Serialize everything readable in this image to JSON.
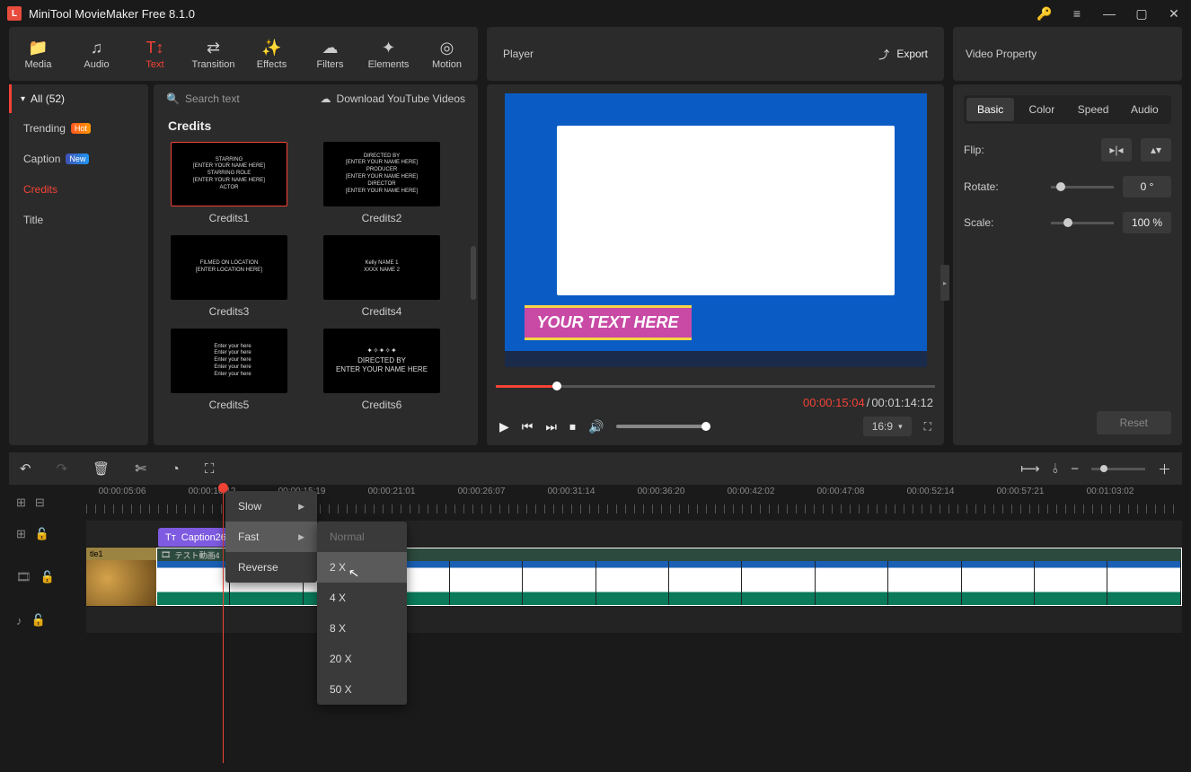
{
  "app": {
    "title": "MiniTool MovieMaker Free 8.1.0"
  },
  "tabs": {
    "media": "Media",
    "audio": "Audio",
    "text": "Text",
    "transition": "Transition",
    "effects": "Effects",
    "filters": "Filters",
    "elements": "Elements",
    "motion": "Motion"
  },
  "player": {
    "title": "Player",
    "export": "Export"
  },
  "props_panel": {
    "title": "Video Property",
    "tabs": {
      "basic": "Basic",
      "color": "Color",
      "speed": "Speed",
      "audio": "Audio"
    },
    "flip": "Flip:",
    "rotate": "Rotate:",
    "rotate_val": "0 °",
    "scale": "Scale:",
    "scale_val": "100 %",
    "reset": "Reset"
  },
  "library": {
    "all": "All (52)",
    "categories": {
      "trending": "Trending",
      "caption": "Caption",
      "credits": "Credits",
      "title": "Title"
    },
    "badges": {
      "hot": "Hot",
      "new": "New"
    },
    "search_placeholder": "Search text",
    "yt": "Download YouTube Videos",
    "section": "Credits",
    "items": [
      "Credits1",
      "Credits2",
      "Credits3",
      "Credits4",
      "Credits5",
      "Credits6"
    ],
    "thumb_texts": {
      "c1": "STARRING\n[ENTER YOUR NAME HERE]\nSTARRING ROLE\n[ENTER YOUR NAME HERE]\nACTOR",
      "c2": "DIRECTED BY\n[ENTER YOUR NAME HERE]\nPRODUCER\n[ENTER YOUR NAME HERE]\nDIRECTOR\n[ENTER YOUR NAME HERE]",
      "c3": "FILMED ON LOCATION\n[ENTER LOCATION HERE]",
      "c4": "Kelly NAME 1\nXXXX NAME 2",
      "c5": "Enter your here\nEnter your here\nEnter your here\nEnter your here\nEnter your here",
      "c6": "✦✧✦✧✦\nDIRECTED BY\nENTER YOUR NAME HERE"
    }
  },
  "preview": {
    "overlay": "YOUR TEXT HERE"
  },
  "time": {
    "current": "00:00:15:04",
    "total": "00:01:14:12",
    "sep": " / "
  },
  "aspect": "16:9",
  "ruler": [
    "00:00:05:06",
    "00:00:10:12",
    "00:00:15:19",
    "00:00:21:01",
    "00:00:26:07",
    "00:00:31:14",
    "00:00:36:20",
    "00:00:42:02",
    "00:00:47:08",
    "00:00:52:14",
    "00:00:57:21",
    "00:01:03:02"
  ],
  "clips": {
    "caption": "Caption26",
    "title": "tle1",
    "video": "テスト動画4"
  },
  "speed_menu": {
    "slow": "Slow",
    "fast": "Fast",
    "reverse": "Reverse",
    "normal": "Normal",
    "options": [
      "2 X",
      "4 X",
      "8 X",
      "20 X",
      "50 X"
    ]
  }
}
